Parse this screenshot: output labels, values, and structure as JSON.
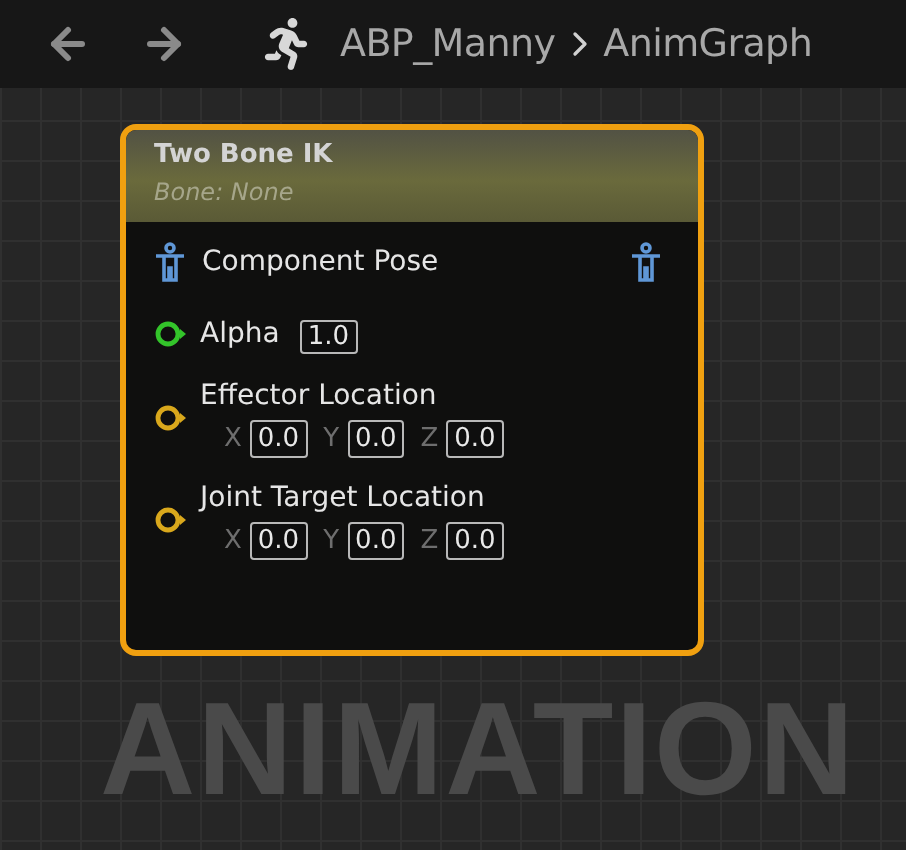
{
  "breadcrumb": {
    "items": [
      "ABP_Manny",
      "AnimGraph"
    ]
  },
  "node": {
    "title": "Two Bone IK",
    "subtitle": "Bone: None",
    "selected": true,
    "pins": [
      {
        "kind": "pose",
        "label": "Component Pose",
        "color": "#5f97d6"
      },
      {
        "kind": "float",
        "label": "Alpha",
        "color": "#33c42a",
        "value": "1.0"
      },
      {
        "kind": "vector",
        "label": "Effector Location",
        "color": "#d9a81c",
        "components": [
          {
            "axis": "X",
            "value": "0.0"
          },
          {
            "axis": "Y",
            "value": "0.0"
          },
          {
            "axis": "Z",
            "value": "0.0"
          }
        ]
      },
      {
        "kind": "vector",
        "label": "Joint Target Location",
        "color": "#d9a81c",
        "components": [
          {
            "axis": "X",
            "value": "0.0"
          },
          {
            "axis": "Y",
            "value": "0.0"
          },
          {
            "axis": "Z",
            "value": "0.0"
          }
        ]
      }
    ]
  },
  "canvas_label": "ANIMATION"
}
